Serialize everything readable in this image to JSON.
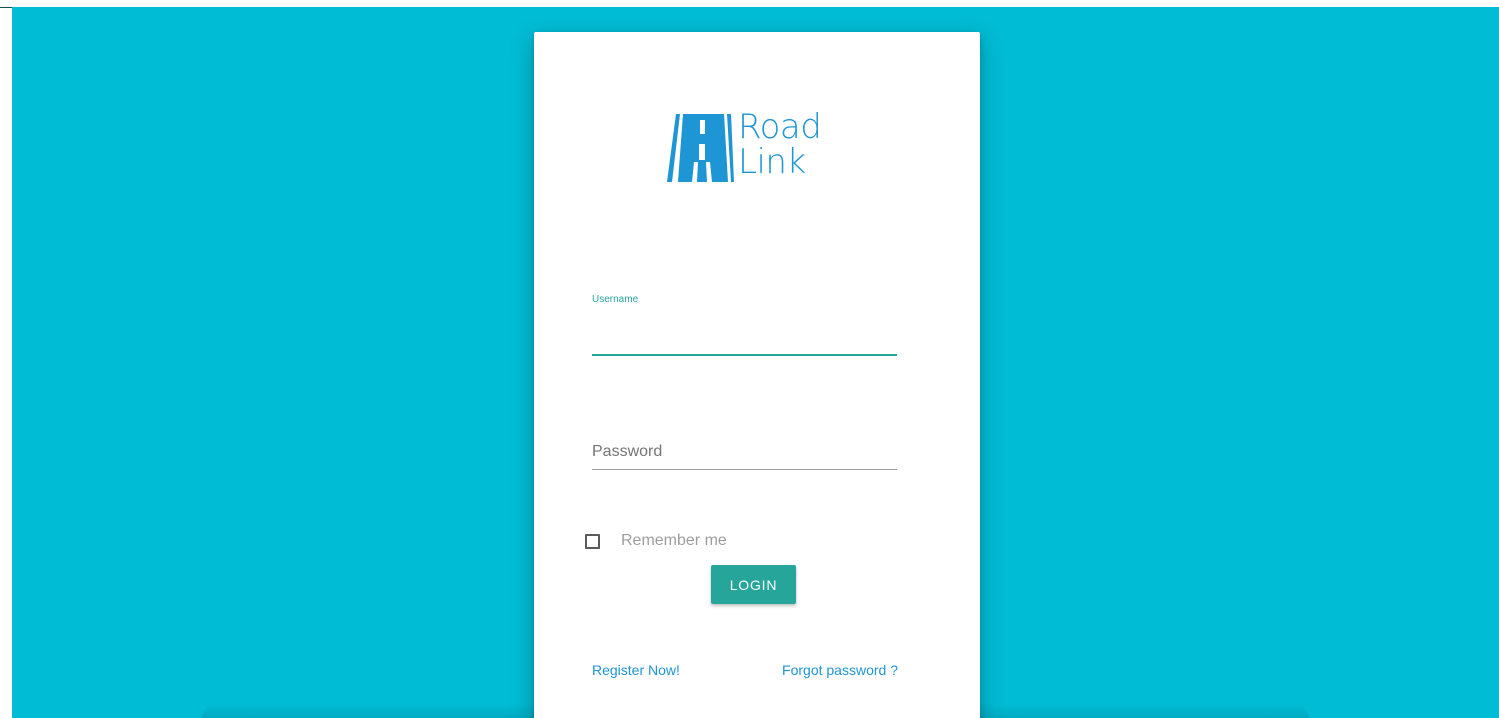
{
  "brand": {
    "line1": "Road",
    "line2": "Link",
    "color": "#1e95d4"
  },
  "colors": {
    "background": "#00bcd4",
    "accent": "#26a69a",
    "link": "#1e95d4"
  },
  "form": {
    "username_label": "Username",
    "username_value": "",
    "password_placeholder": "Password",
    "password_value": "",
    "remember_label": "Remember me",
    "remember_checked": false,
    "login_label": "LOGIN"
  },
  "links": {
    "register": "Register Now!",
    "forgot": "Forgot password ?"
  }
}
